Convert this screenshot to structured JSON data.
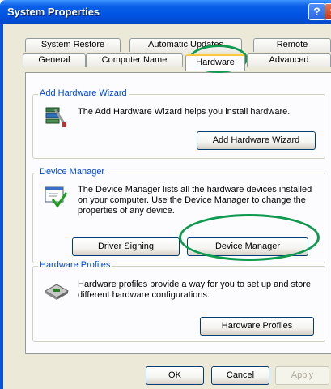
{
  "window": {
    "title": "System Properties",
    "help_label": "?",
    "close_label": "x"
  },
  "tabs": {
    "row1": [
      "System Restore",
      "Automatic Updates",
      "Remote"
    ],
    "row2": [
      "General",
      "Computer Name",
      "Hardware",
      "Advanced"
    ],
    "active": "Hardware"
  },
  "add_hardware": {
    "legend": "Add Hardware Wizard",
    "text": "The Add Hardware Wizard helps you install hardware.",
    "button": "Add Hardware Wizard",
    "icon": "add-hardware-wizard-icon"
  },
  "device_manager": {
    "legend": "Device Manager",
    "text": "The Device Manager lists all the hardware devices installed on your computer. Use the Device Manager to change the properties of any device.",
    "driver_button": "Driver Signing",
    "button": "Device Manager",
    "icon": "device-manager-icon"
  },
  "hardware_profiles": {
    "legend": "Hardware Profiles",
    "text": "Hardware profiles provide a way for you to set up and store different hardware configurations.",
    "button": "Hardware Profiles",
    "icon": "hardware-profiles-icon"
  },
  "footer": {
    "ok": "OK",
    "cancel": "Cancel",
    "apply": "Apply"
  },
  "colors": {
    "titlebar": "#0054e3",
    "highlight_ring": "#0e9a4e",
    "legend": "#0046d5",
    "dialog_bg": "#ece9d8"
  }
}
